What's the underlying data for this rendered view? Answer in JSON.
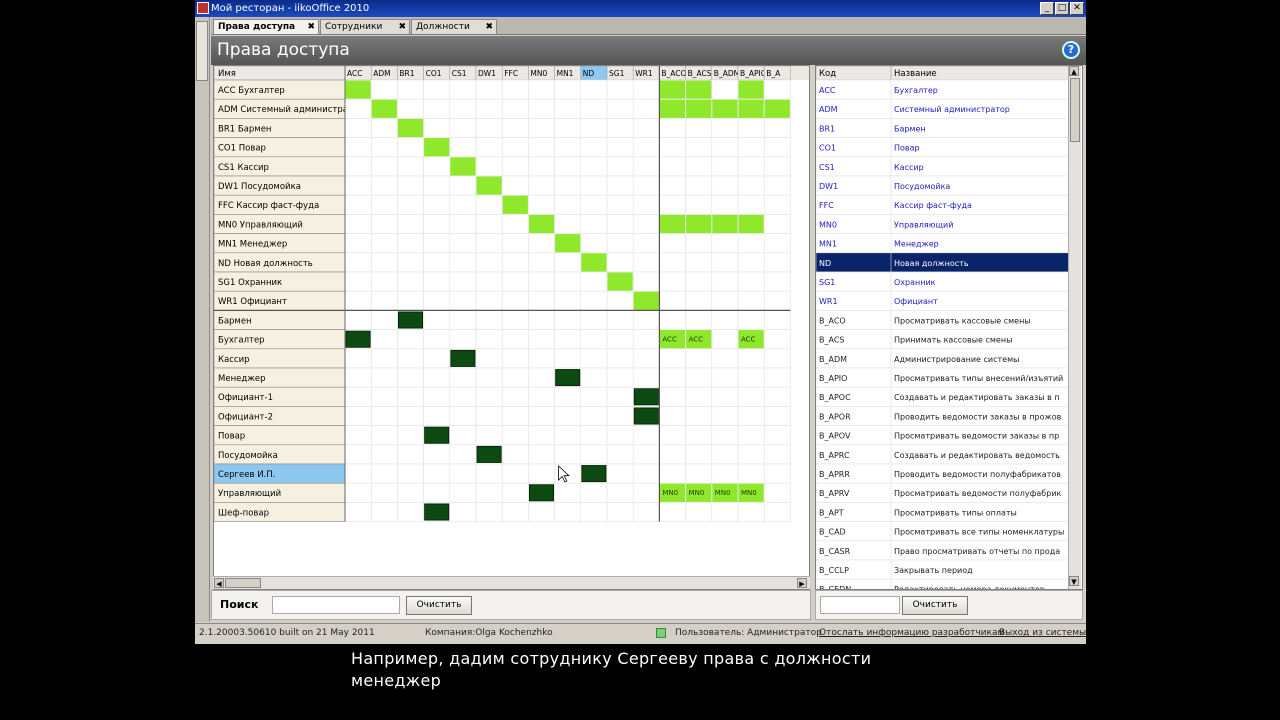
{
  "window": {
    "title": "Мой ресторан - iikoOffice 2010",
    "minimize": "_",
    "maximize": "□",
    "close": "✕"
  },
  "tabs": [
    {
      "label": "Права доступа",
      "active": true
    },
    {
      "label": "Сотрудники",
      "active": false
    },
    {
      "label": "Должности",
      "active": false
    }
  ],
  "tab_close": "✖",
  "page": {
    "title": "Права доступа",
    "help": "?"
  },
  "grid": {
    "name_header": "Имя",
    "columns": [
      "ACC",
      "ADM",
      "BR1",
      "CO1",
      "CS1",
      "DW1",
      "FFC",
      "MN0",
      "MN1",
      "ND",
      "SG1",
      "WR1",
      "B_ACO",
      "B_ACS",
      "B_ADM",
      "B_APIO",
      "B_A"
    ],
    "selected_column": "ND",
    "role_rows": [
      {
        "name": "ACC Бухгалтер",
        "cells": [
          0,
          12,
          13,
          15
        ]
      },
      {
        "name": "ADM Системный администратор",
        "cells": [
          1,
          12,
          13,
          14,
          15,
          16
        ]
      },
      {
        "name": "BR1 Бармен",
        "cells": [
          2
        ]
      },
      {
        "name": "CO1 Повар",
        "cells": [
          3
        ]
      },
      {
        "name": "CS1 Кассир",
        "cells": [
          4
        ]
      },
      {
        "name": "DW1 Посудомойка",
        "cells": [
          5
        ]
      },
      {
        "name": "FFC Кассир фаст-фуда",
        "cells": [
          6
        ]
      },
      {
        "name": "MN0 Управляющий",
        "cells": [
          7,
          12,
          13,
          14,
          15
        ]
      },
      {
        "name": "MN1 Менеджер",
        "cells": [
          8
        ]
      },
      {
        "name": "ND Новая должность",
        "cells": [
          9
        ]
      },
      {
        "name": "SG1 Охранник",
        "cells": [
          10
        ]
      },
      {
        "name": "WR1 Официант",
        "cells": [
          11
        ]
      }
    ],
    "employee_rows": [
      {
        "name": "Бармен",
        "dark": [
          2
        ],
        "light": []
      },
      {
        "name": "Бухгалтер",
        "dark": [
          0
        ],
        "light": [
          {
            "col": 12,
            "label": "ACC"
          },
          {
            "col": 13,
            "label": "ACC"
          },
          {
            "col": 15,
            "label": "ACC"
          }
        ]
      },
      {
        "name": "Кассир",
        "dark": [
          4
        ],
        "light": []
      },
      {
        "name": "Менеджер",
        "dark": [
          8
        ],
        "light": []
      },
      {
        "name": "Официант-1",
        "dark": [
          11
        ],
        "light": []
      },
      {
        "name": "Официант-2",
        "dark": [
          11
        ],
        "light": []
      },
      {
        "name": "Повар",
        "dark": [
          3
        ],
        "light": []
      },
      {
        "name": "Посудомойка",
        "dark": [
          5
        ],
        "light": []
      },
      {
        "name": "Сергеев И.П.",
        "dark": [
          9
        ],
        "light": [],
        "selected": true
      },
      {
        "name": "Управляющий",
        "dark": [
          7
        ],
        "light": [
          {
            "col": 12,
            "label": "MN0"
          },
          {
            "col": 13,
            "label": "MN0"
          },
          {
            "col": 14,
            "label": "MN0"
          },
          {
            "col": 15,
            "label": "MN0"
          }
        ]
      },
      {
        "name": "Шеф-повар",
        "dark": [
          3
        ],
        "light": []
      }
    ]
  },
  "search": {
    "label": "Поиск",
    "placeholder": "",
    "clear_button": "Очистить"
  },
  "rights": {
    "header_code": "Код",
    "header_name": "Название",
    "selected_code": "ND",
    "rows": [
      {
        "code": "ACC",
        "name": "Бухгалтер",
        "role": true
      },
      {
        "code": "ADM",
        "name": "Системный администратор",
        "role": true
      },
      {
        "code": "BR1",
        "name": "Бармен",
        "role": true
      },
      {
        "code": "CO1",
        "name": "Повар",
        "role": true
      },
      {
        "code": "CS1",
        "name": "Кассир",
        "role": true
      },
      {
        "code": "DW1",
        "name": "Посудомойка",
        "role": true
      },
      {
        "code": "FFC",
        "name": "Кассир фаст-фуда",
        "role": true
      },
      {
        "code": "MN0",
        "name": "Управляющий",
        "role": true
      },
      {
        "code": "MN1",
        "name": "Менеджер",
        "role": true
      },
      {
        "code": "ND",
        "name": "Новая должность",
        "role": true
      },
      {
        "code": "SG1",
        "name": "Охранник",
        "role": true
      },
      {
        "code": "WR1",
        "name": "Официант",
        "role": true
      },
      {
        "code": "B_ACO",
        "name": "Просматривать кассовые смены",
        "role": false
      },
      {
        "code": "B_ACS",
        "name": "Принимать кассовые смены",
        "role": false
      },
      {
        "code": "B_ADM",
        "name": "Администрирование системы",
        "role": false
      },
      {
        "code": "B_APIO",
        "name": "Просматривать типы внесений/изъятий",
        "role": false
      },
      {
        "code": "B_APOC",
        "name": "Создавать и редактировать заказы в п",
        "role": false
      },
      {
        "code": "B_APOR",
        "name": "Проводить ведомости заказы в прожов",
        "role": false
      },
      {
        "code": "B_APOV",
        "name": "Просматривать ведомости заказы в пр",
        "role": false
      },
      {
        "code": "B_APRC",
        "name": "Создавать и редактировать ведомость",
        "role": false
      },
      {
        "code": "B_APRR",
        "name": "Проводить ведомости полуфабрикатов",
        "role": false
      },
      {
        "code": "B_APRV",
        "name": "Просматривать ведомости полуфабрик",
        "role": false
      },
      {
        "code": "B_APT",
        "name": "Просматривать типы оплаты",
        "role": false
      },
      {
        "code": "B_CAD",
        "name": "Просматривать все типы номенклатуры",
        "role": false
      },
      {
        "code": "B_CASR",
        "name": "Право просматривать отчеты по прода",
        "role": false
      },
      {
        "code": "B_CCLP",
        "name": "Закрывать период",
        "role": false
      },
      {
        "code": "B_CEDN",
        "name": "Редактировать номера документов",
        "role": false
      }
    ]
  },
  "statusbar": {
    "version": "2.1.20003.50610 built on 21 May 2011",
    "company": "Компания:Olga Kochenzhko",
    "user": "Пользователь: Администратор",
    "send_info": "Отослать информацию разработчикам",
    "logout": "Выход из системы"
  },
  "caption": {
    "line1": "Например, дадим сотруднику Сергееву права с должности",
    "line2": "менеджер"
  },
  "colors": {
    "light_green": "#8fe82c",
    "dark_green": "#0c4a12",
    "selected_blue": "#8cc8f0",
    "selected_row_dark": "#0a246a",
    "link_blue": "#2020c0",
    "name_cell": "#f5f0e0"
  }
}
